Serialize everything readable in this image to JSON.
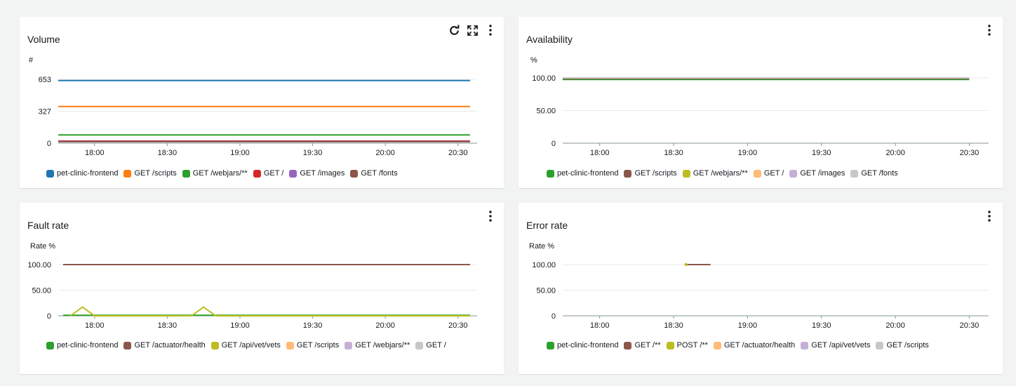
{
  "panels": [
    {
      "title": "Volume",
      "unit": "#",
      "menu_icon": "kebab-menu-icon",
      "tools": [
        "refresh-icon",
        "expand-icon"
      ],
      "chart_data": {
        "type": "line",
        "title": "Volume",
        "ylabel": "#",
        "x_range": [
          "17:45",
          "20:35"
        ],
        "y_range": [
          0,
          653
        ],
        "y_ticks": [
          "653",
          "327",
          "0"
        ],
        "x_ticks": [
          "18:00",
          "18:30",
          "19:00",
          "19:30",
          "20:00",
          "20:30"
        ],
        "grid": true,
        "legend_position": "bottom",
        "series": [
          {
            "name": "pet-clinic-frontend",
            "color": "#1f77b4",
            "points": [
              [
                "17:45",
                640
              ],
              [
                "20:35",
                640
              ]
            ]
          },
          {
            "name": "GET /scripts",
            "color": "#ff7f0e",
            "points": [
              [
                "17:45",
                375
              ],
              [
                "20:35",
                375
              ]
            ]
          },
          {
            "name": "GET /webjars/**",
            "color": "#2ca02c",
            "points": [
              [
                "17:45",
                85
              ],
              [
                "20:35",
                85
              ]
            ]
          },
          {
            "name": "GET /",
            "color": "#d62728",
            "points": [
              [
                "17:45",
                22
              ],
              [
                "20:35",
                22
              ]
            ]
          },
          {
            "name": "GET /images",
            "color": "#9467bd",
            "points": [
              [
                "17:45",
                18
              ],
              [
                "20:35",
                18
              ]
            ]
          },
          {
            "name": "GET /fonts",
            "color": "#8c564b",
            "points": [
              [
                "17:45",
                15
              ],
              [
                "20:35",
                15
              ]
            ]
          }
        ]
      }
    },
    {
      "title": "Availability",
      "unit": "%",
      "menu_icon": "kebab-menu-icon",
      "tools": [],
      "chart_data": {
        "type": "line",
        "title": "Availability",
        "ylabel": "%",
        "x_range": [
          "17:45",
          "20:35"
        ],
        "y_range": [
          0,
          100
        ],
        "y_ticks": [
          "100.00",
          "50.00",
          "0"
        ],
        "x_ticks": [
          "18:00",
          "18:30",
          "19:00",
          "19:30",
          "20:00",
          "20:30"
        ],
        "grid": true,
        "legend_position": "bottom",
        "series": [
          {
            "name": "pet-clinic-frontend",
            "color": "#2ca02c",
            "points": [
              [
                "17:45",
                97.5
              ],
              [
                "20:30",
                97.5
              ]
            ]
          },
          {
            "name": "GET /scripts",
            "color": "#8c564b",
            "points": [
              [
                "17:45",
                99
              ],
              [
                "20:30",
                99
              ]
            ]
          },
          {
            "name": "GET /webjars/**",
            "color": "#bcbd22",
            "points": [
              [
                "17:45",
                100
              ],
              [
                "20:30",
                100
              ]
            ]
          },
          {
            "name": "GET /",
            "color": "#ffbb78",
            "points": [
              [
                "17:45",
                100
              ],
              [
                "20:30",
                100
              ]
            ]
          },
          {
            "name": "GET /images",
            "color": "#c5b0d5",
            "points": [
              [
                "17:45",
                100
              ],
              [
                "20:30",
                100
              ]
            ]
          },
          {
            "name": "GET /fonts",
            "color": "#c7c7c7",
            "points": [
              [
                "17:45",
                100
              ],
              [
                "20:30",
                100
              ]
            ]
          }
        ]
      }
    },
    {
      "title": "Fault rate",
      "unit": "Rate %",
      "menu_icon": "kebab-menu-icon",
      "tools": [],
      "chart_data": {
        "type": "line",
        "title": "Fault rate",
        "ylabel": "Rate %",
        "x_range": [
          "17:45",
          "20:35"
        ],
        "y_range": [
          0,
          100
        ],
        "y_ticks": [
          "100.00",
          "50.00",
          "0"
        ],
        "x_ticks": [
          "18:00",
          "18:30",
          "19:00",
          "19:30",
          "20:00",
          "20:30"
        ],
        "grid": true,
        "legend_position": "bottom",
        "series": [
          {
            "name": "pet-clinic-frontend",
            "color": "#2ca02c",
            "points": [
              [
                "17:47",
                1
              ],
              [
                "20:35",
                1
              ]
            ]
          },
          {
            "name": "GET /actuator/health",
            "color": "#8c564b",
            "points": [
              [
                "17:47",
                100
              ],
              [
                "20:35",
                100
              ]
            ]
          },
          {
            "name": "GET /api/vet/vets",
            "color": "#bcbd22",
            "points": [
              [
                "17:50",
                0
              ],
              [
                "17:55",
                17
              ],
              [
                "18:00",
                0
              ],
              [
                "18:40",
                0
              ],
              [
                "18:45",
                17
              ],
              [
                "18:50",
                0
              ],
              [
                "20:35",
                0
              ]
            ]
          },
          {
            "name": "GET /scripts",
            "color": "#ffbb78",
            "points": []
          },
          {
            "name": "GET /webjars/**",
            "color": "#c5b0d5",
            "points": []
          },
          {
            "name": "GET /",
            "color": "#c7c7c7",
            "points": []
          }
        ]
      }
    },
    {
      "title": "Error rate",
      "unit": "Rate %",
      "menu_icon": "kebab-menu-icon",
      "tools": [],
      "chart_data": {
        "type": "line",
        "title": "Error rate",
        "ylabel": "Rate %",
        "x_range": [
          "17:45",
          "20:35"
        ],
        "y_range": [
          0,
          100
        ],
        "y_ticks": [
          "100.00",
          "50.00",
          "0"
        ],
        "x_ticks": [
          "18:00",
          "18:30",
          "19:00",
          "19:30",
          "20:00",
          "20:30"
        ],
        "grid": true,
        "legend_position": "bottom",
        "series": [
          {
            "name": "pet-clinic-frontend",
            "color": "#2ca02c",
            "points": []
          },
          {
            "name": "GET /**",
            "color": "#8c564b",
            "points": [
              [
                "18:35",
                100
              ],
              [
                "18:45",
                100
              ]
            ]
          },
          {
            "name": "POST /**",
            "color": "#bcbd22",
            "points": [
              [
                "18:35",
                100
              ]
            ]
          },
          {
            "name": "GET /actuator/health",
            "color": "#ffbb78",
            "points": []
          },
          {
            "name": "GET /api/vet/vets",
            "color": "#c5b0d5",
            "points": []
          },
          {
            "name": "GET /scripts",
            "color": "#c7c7c7",
            "points": []
          }
        ]
      }
    }
  ]
}
